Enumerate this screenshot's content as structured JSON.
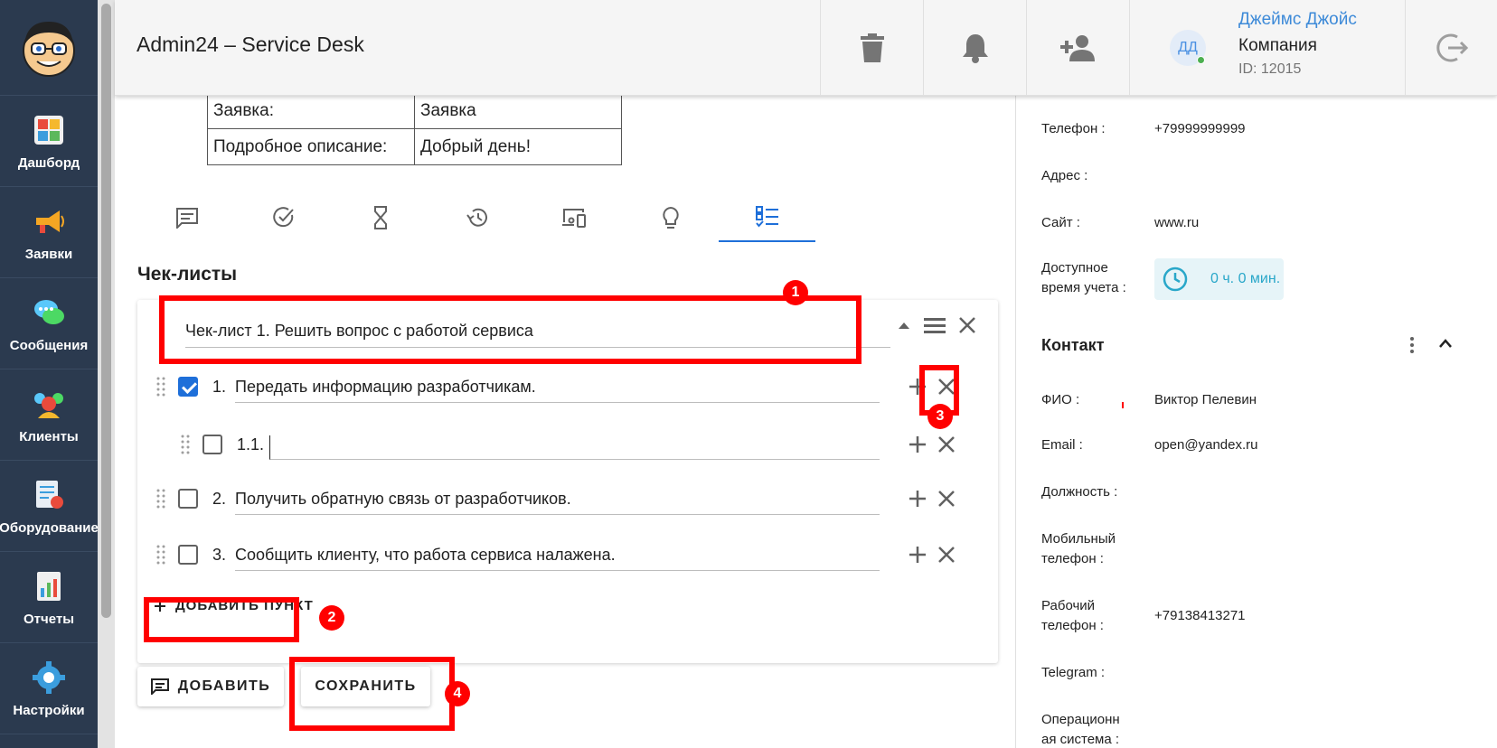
{
  "header": {
    "app_title": "Admin24 – Service Desk",
    "user_initials": "ДД",
    "user_name": "Джеймс Джойс",
    "company": "Компания",
    "user_id": "ID: 12015"
  },
  "sidebar": {
    "items": [
      {
        "label": "Дашборд"
      },
      {
        "label": "Заявки"
      },
      {
        "label": "Сообщения"
      },
      {
        "label": "Клиенты"
      },
      {
        "label": "Оборудование"
      },
      {
        "label": "Отчеты"
      },
      {
        "label": "Настройки"
      }
    ]
  },
  "info_table": [
    {
      "key": "Заявка:",
      "value": "Заявка"
    },
    {
      "key": "Подробное описание:",
      "value": "Добрый день!"
    }
  ],
  "section_title": "Чек-листы",
  "checklist": {
    "title": "Чек-лист 1. Решить вопрос с работой сервиса",
    "items": [
      {
        "num": "1.",
        "text": "Передать информацию разработчикам.",
        "checked": true
      },
      {
        "num": "1.1.",
        "text": "",
        "checked": false
      },
      {
        "num": "2.",
        "text": "Получить обратную связь от разработчиков.",
        "checked": false
      },
      {
        "num": "3.",
        "text": "Сообщить клиенту, что работа сервиса налажена.",
        "checked": false
      }
    ],
    "add_item_label": "ДОБАВИТЬ ПУНКТ"
  },
  "buttons": {
    "add": "ДОБАВИТЬ",
    "save": "СОХРАНИТЬ"
  },
  "client_info": {
    "phone_label": "Телефон :",
    "phone": "+79999999999",
    "address_label": "Адрес :",
    "site_label": "Сайт :",
    "site": "www.ru",
    "time_label": "Доступное время учета :",
    "time_value": "0 ч. 0 мин."
  },
  "contact": {
    "title": "Контакт",
    "fio_label": "ФИО :",
    "fio": "Виктор Пелевин",
    "email_label": "Email :",
    "email": "open@yandex.ru",
    "position_label": "Должность :",
    "mobile_label": "Мобильный телефон :",
    "work_phone_label": "Рабочий телефон :",
    "work_phone": "+79138413271",
    "telegram_label": "Telegram :",
    "os_label": "Операционная система :"
  },
  "annotations": [
    "1",
    "2",
    "3",
    "4"
  ],
  "colors": {
    "sidebar_bg": "#2b3a4f",
    "accent": "#1e6fd9",
    "annotation": "#ff0000",
    "user_link": "#3d8ad8",
    "time_text": "#29a7c9"
  }
}
